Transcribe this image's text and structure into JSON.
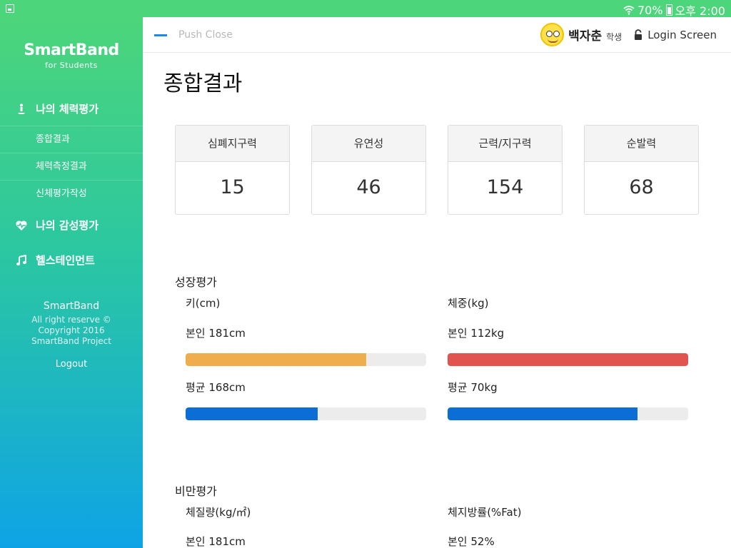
{
  "status_bar": {
    "battery": "70%",
    "time": "오후 2:00"
  },
  "sidebar": {
    "brand": "SmartBand",
    "brand_sub": "for Students",
    "menu": [
      {
        "label": "나의 체력평가",
        "icon": "figure-icon"
      },
      {
        "label": "나의 감성평가",
        "icon": "heartbeat-icon"
      },
      {
        "label": "헬스테인먼트",
        "icon": "music-note-icon"
      }
    ],
    "submenu": [
      "종합결과",
      "체력측정결과",
      "신체평가작성"
    ],
    "footer": {
      "brand": "SmartBand",
      "copy1": "All right reserve ©",
      "copy2": "Copyright 2016",
      "copy3": "SmartBand Project",
      "logout": "Logout"
    }
  },
  "topbar": {
    "push_close": "Push Close",
    "user_name": "백자춘",
    "user_role": "학생",
    "login": "Login Screen"
  },
  "main": {
    "title": "종합결과",
    "cards": [
      {
        "label": "심폐지구력",
        "value": "15"
      },
      {
        "label": "유연성",
        "value": "46"
      },
      {
        "label": "근력/지구력",
        "value": "154"
      },
      {
        "label": "순발력",
        "value": "68"
      }
    ],
    "growth": {
      "title": "성장평가",
      "height": {
        "label": "키(cm)",
        "self": "본인 181cm",
        "avg": "평균 168cm",
        "self_pct": 75,
        "avg_pct": 55
      },
      "weight": {
        "label": "체중(kg)",
        "self": "본인 112kg",
        "avg": "평균 70kg",
        "self_pct": 100,
        "avg_pct": 79
      }
    },
    "obesity": {
      "title": "비만평가",
      "bmi": {
        "label": "체질량(kg/㎡)",
        "self": "본인 181cm"
      },
      "fat": {
        "label": "체지방률(%Fat)",
        "self": "본인 52%"
      }
    },
    "colors": {
      "orange": "#f0ad4e",
      "red": "#e0534e",
      "blue": "#0a6ed6"
    }
  }
}
